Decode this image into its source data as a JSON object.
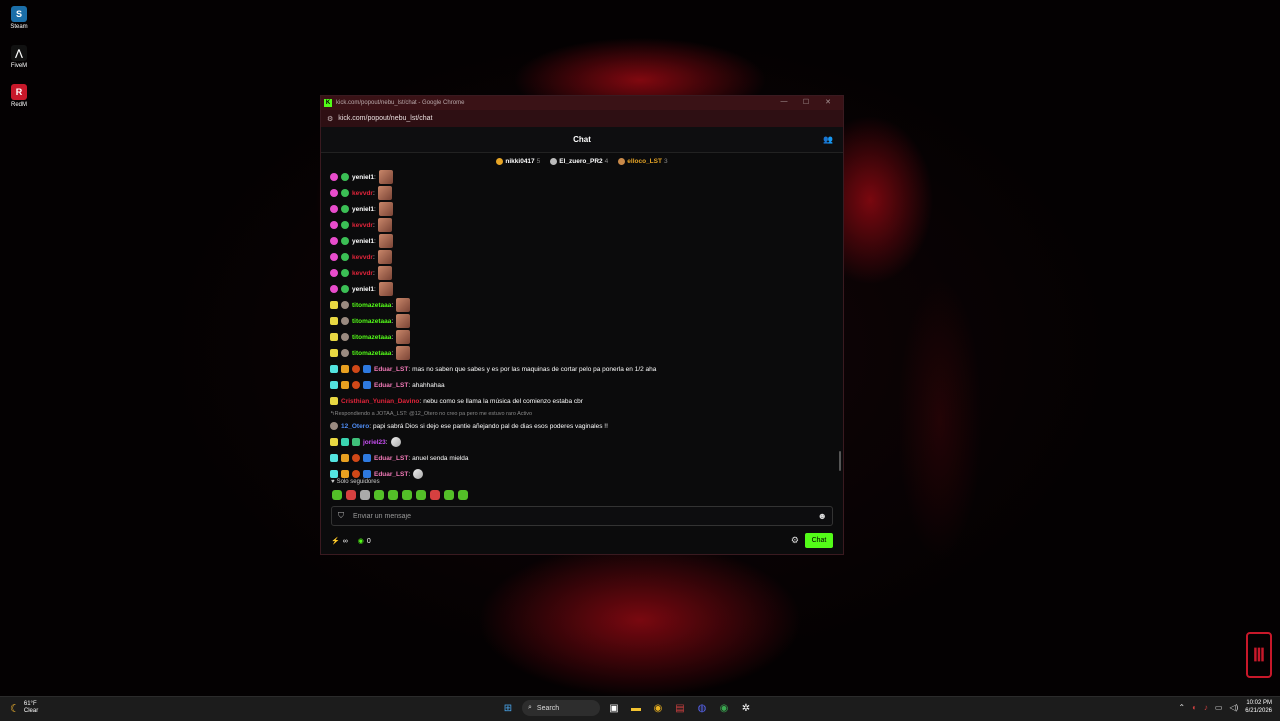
{
  "desktop": {
    "icons": [
      {
        "label": "Steam",
        "icon": "steam-icon",
        "color": "#1b6ea8",
        "glyph": "S"
      },
      {
        "label": "FiveM",
        "icon": "fivem-icon",
        "color": "#111111",
        "glyph": "⋀"
      },
      {
        "label": "RedM",
        "icon": "redm-icon",
        "color": "#c8182a",
        "glyph": "R"
      }
    ]
  },
  "browser": {
    "title": "kick.com/popout/nebu_lst/chat - Google Chrome",
    "url": "kick.com/popout/nebu_lst/chat",
    "controls": [
      "—",
      "☐",
      "✕"
    ]
  },
  "chat": {
    "title": "Chat",
    "pinned": [
      {
        "name": "nikki0417",
        "count": "5",
        "color": "#e7a526"
      },
      {
        "name": "El_zuero_PR2",
        "count": "4",
        "color": "#bbbbbb"
      },
      {
        "name": "elloco_LST",
        "count": "3",
        "color": "#c98a4a",
        "namecolor": "#e7a526"
      }
    ],
    "messages": [
      {
        "badges": [
          "sub",
          "og"
        ],
        "user": "yeniel1",
        "color": "#ffffff",
        "text": "",
        "emote": true
      },
      {
        "badges": [
          "sub",
          "og"
        ],
        "user": "kevvdr",
        "color": "#e0243a",
        "text": "",
        "emote": true
      },
      {
        "badges": [
          "sub",
          "og"
        ],
        "user": "yeniel1",
        "color": "#ffffff",
        "text": "",
        "emote": true
      },
      {
        "badges": [
          "sub",
          "og"
        ],
        "user": "kevvdr",
        "color": "#e0243a",
        "text": "",
        "emote": true
      },
      {
        "badges": [
          "sub",
          "og"
        ],
        "user": "yeniel1",
        "color": "#ffffff",
        "text": "",
        "emote": true
      },
      {
        "badges": [
          "sub",
          "og"
        ],
        "user": "kevvdr",
        "color": "#e0243a",
        "text": "",
        "emote": true
      },
      {
        "badges": [
          "sub",
          "og"
        ],
        "user": "kevvdr",
        "color": "#e0243a",
        "text": "",
        "emote": true
      },
      {
        "badges": [
          "sub",
          "og"
        ],
        "user": "yeniel1",
        "color": "#ffffff",
        "text": "",
        "emote": true
      },
      {
        "badges": [
          "vip",
          "dot"
        ],
        "user": "titomazetaaa",
        "color": "#53fc18",
        "text": "",
        "emote": true
      },
      {
        "badges": [
          "vip",
          "dot"
        ],
        "user": "titomazetaaa",
        "color": "#53fc18",
        "text": "",
        "emote": true
      },
      {
        "badges": [
          "vip",
          "dot"
        ],
        "user": "titomazetaaa",
        "color": "#53fc18",
        "text": "",
        "emote": true
      },
      {
        "badges": [
          "vip",
          "dot"
        ],
        "user": "titomazetaaa",
        "color": "#53fc18",
        "text": "",
        "emote": true
      },
      {
        "badges": [
          "mod",
          "crown",
          "wolf",
          "sword"
        ],
        "user": "Eduar_LST",
        "color": "#f27ab8",
        "text": "mas no saben que sabes y es por las maquinas de cortar pelo pa ponerla en 1/2 aha",
        "emote": false
      },
      {
        "badges": [
          "mod",
          "crown",
          "wolf",
          "sword"
        ],
        "user": "Eduar_LST",
        "color": "#f27ab8",
        "text": "ahahhahaa",
        "emote": false
      },
      {
        "badges": [
          "vip"
        ],
        "user": "Cristhian_Yunian_Davino",
        "color": "#e0243a",
        "text": "nebu como se llama la música del comienzo estaba cbr",
        "emote": false
      },
      {
        "reply": "Respondiendo a JOTAA_LST: @12_Otero no creo pa pero me estuvo raro Activo"
      },
      {
        "badges": [
          "glob"
        ],
        "user": "12_Otero",
        "color": "#4f8df5",
        "text": "papi sabrá Dios si dejo ese pantie añejando pal de dias esos poderes vaginales !!",
        "emote": false
      },
      {
        "badges": [
          "vip",
          "gift",
          "gear"
        ],
        "user": "joriel23",
        "color": "#c94ff5",
        "text": "",
        "emote": "small"
      },
      {
        "badges": [
          "mod",
          "crown",
          "wolf",
          "sword"
        ],
        "user": "Eduar_LST",
        "color": "#f27ab8",
        "text": "anuel senda mielda",
        "emote": false
      },
      {
        "badges": [
          "mod",
          "crown",
          "wolf",
          "sword"
        ],
        "user": "Eduar_LST",
        "color": "#f27ab8",
        "text": "",
        "emote": "small"
      }
    ],
    "followers_only": "Solo seguidores",
    "input_placeholder": "Enviar un mensaje",
    "points_label": "∞",
    "kick_points": "0",
    "send_label": "Chat"
  },
  "taskbar": {
    "weather_temp": "61°F",
    "weather_cond": "Clear",
    "search_label": "Search",
    "time": "10:02 PM",
    "date": "6/21/2026"
  },
  "colors": {
    "accent": "#53fc18"
  }
}
